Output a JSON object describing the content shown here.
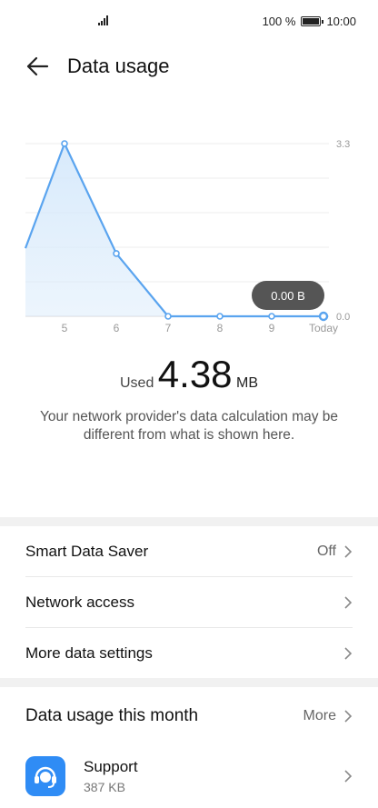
{
  "status_bar": {
    "battery": "100 %",
    "time": "10:00"
  },
  "header": {
    "title": "Data usage"
  },
  "chart_data": {
    "type": "area",
    "categories": [
      "5",
      "6",
      "7",
      "8",
      "9",
      "Today"
    ],
    "values": [
      3.3,
      1.2,
      0.0,
      0.0,
      0.0,
      0.0
    ],
    "y_tick_labels": [
      "3.3",
      "0.0"
    ],
    "ylim": [
      0,
      3.3
    ],
    "tooltip": "0.00 B",
    "line_color": "#5aa4ef",
    "fill_color": "#d6e9fb"
  },
  "summary": {
    "used_label": "Used",
    "amount": "4.38",
    "unit": "MB",
    "disclaimer": "Your network provider's data calculation may be different from what is shown here."
  },
  "settings": {
    "smart_data_saver": {
      "label": "Smart Data Saver",
      "value": "Off"
    },
    "network_access": {
      "label": "Network access"
    },
    "more_data_settings": {
      "label": "More data settings"
    }
  },
  "month": {
    "title": "Data usage this month",
    "more_label": "More",
    "apps": [
      {
        "name": "Support",
        "size": "387 KB"
      }
    ]
  }
}
